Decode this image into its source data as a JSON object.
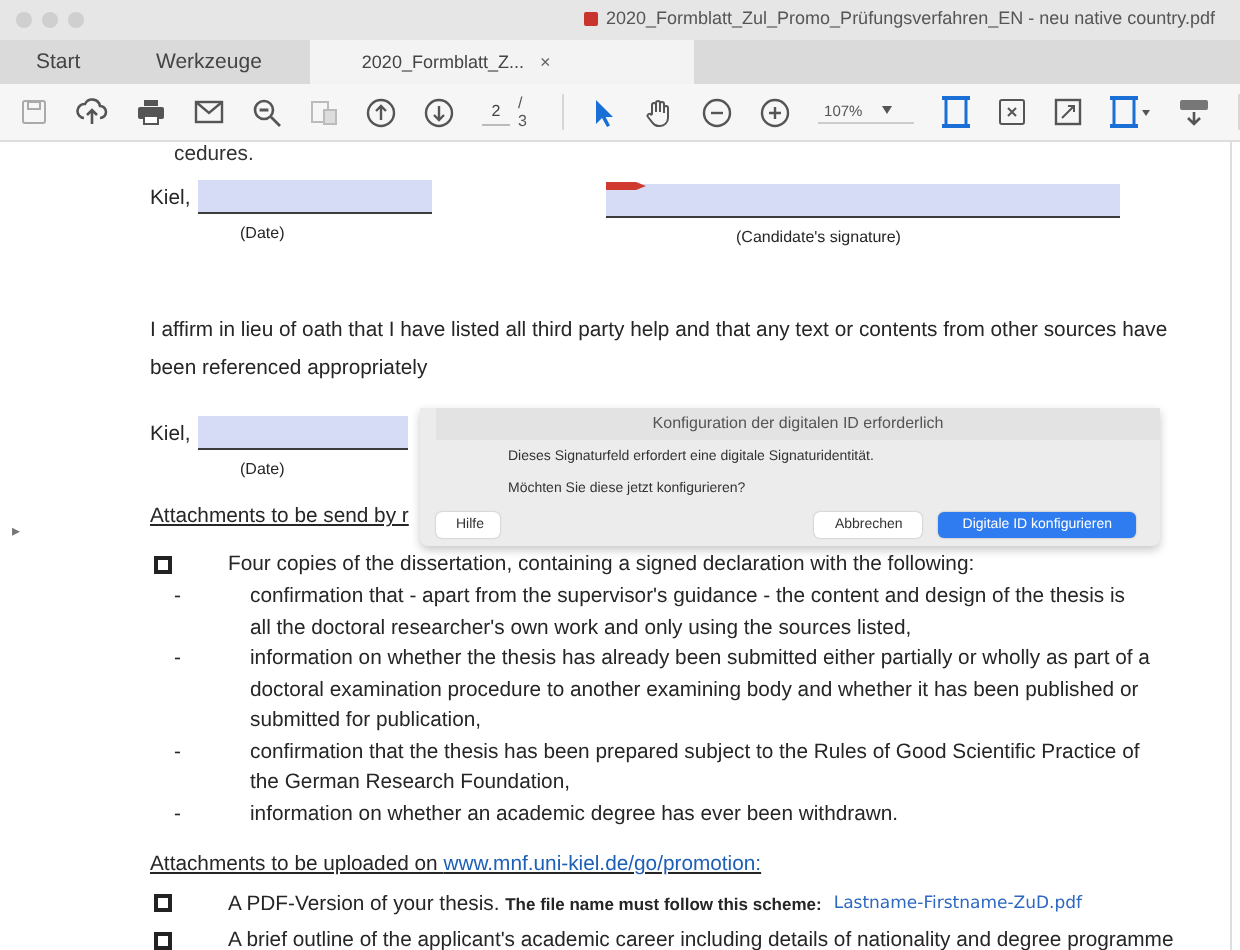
{
  "window": {
    "title": "2020_Formblatt_Zul_Promo_Prüfungsverfahren_EN - neu native country.pdf"
  },
  "tabs": [
    {
      "label": "Start",
      "selected": false
    },
    {
      "label": "Werkzeuge",
      "selected": false
    },
    {
      "label": "2020_Formblatt_Z...",
      "selected": true,
      "close": "×"
    }
  ],
  "toolbar": {
    "page_value": "2",
    "page_total": "/ 3",
    "zoom": "107%"
  },
  "side_panel_toggle": "▸",
  "document": {
    "top_text": "cedures.",
    "signature_block": {
      "place": "Kiel,",
      "date_label": "(Date)",
      "signature_label": "(Candidate's signature)"
    },
    "affirmation": "I affirm in lieu of oath that I have listed all third party help and that any text or contents from other sources have been referenced appropriately",
    "second_block": {
      "place": "Kiel,",
      "date_label": "(Date)"
    },
    "attachments_heading": "Attachments to be send by r",
    "attachments": [
      {
        "text": "Four copies of the dissertation, containing a signed declaration with the following:",
        "sub_items": [
          {
            "dash": "-",
            "text": "confirmation that - apart from the supervisor's guidance - the content and design of the thesis is all the doctoral researcher's own work and only using the sources listed,"
          },
          {
            "dash": "-",
            "text": "information on whether the thesis has already been submitted either partially or wholly as part of a doctoral examination procedure to another examining body and whether it has been published or submitted for publication,"
          },
          {
            "dash": "-",
            "text": "confirmation that the thesis has been prepared subject to the Rules of Good Scientific Practice of the German Research Foundation,"
          },
          {
            "dash": "-",
            "text": "information on whether an academic degree has ever been withdrawn."
          }
        ]
      }
    ],
    "upload_heading": "Attachments to be uploaded on ",
    "upload_link": "www.mnf.uni-kiel.de/go/promotion:",
    "uploads": [
      {
        "text": "A PDF-Version of your thesis. **The file name must follow this scheme:**",
        "example": "Lastname-Firstname-ZuD.pdf"
      },
      {
        "text": "A brief outline of the applicant's academic career including details of nationality and degree programme"
      }
    ]
  },
  "dialog": {
    "title": "Konfiguration der digitalen ID erforderlich",
    "messages": [
      "Dieses Signaturfeld erfordert eine digitale Signaturidentität.",
      "Möchten Sie diese jetzt konfigurieren?"
    ],
    "buttons": [
      {
        "label": "Hilfe",
        "kind": "help"
      },
      {
        "label": "Abbrechen",
        "kind": "secondary"
      },
      {
        "label": "Digitale ID konfigurieren",
        "kind": "primary"
      }
    ]
  }
}
